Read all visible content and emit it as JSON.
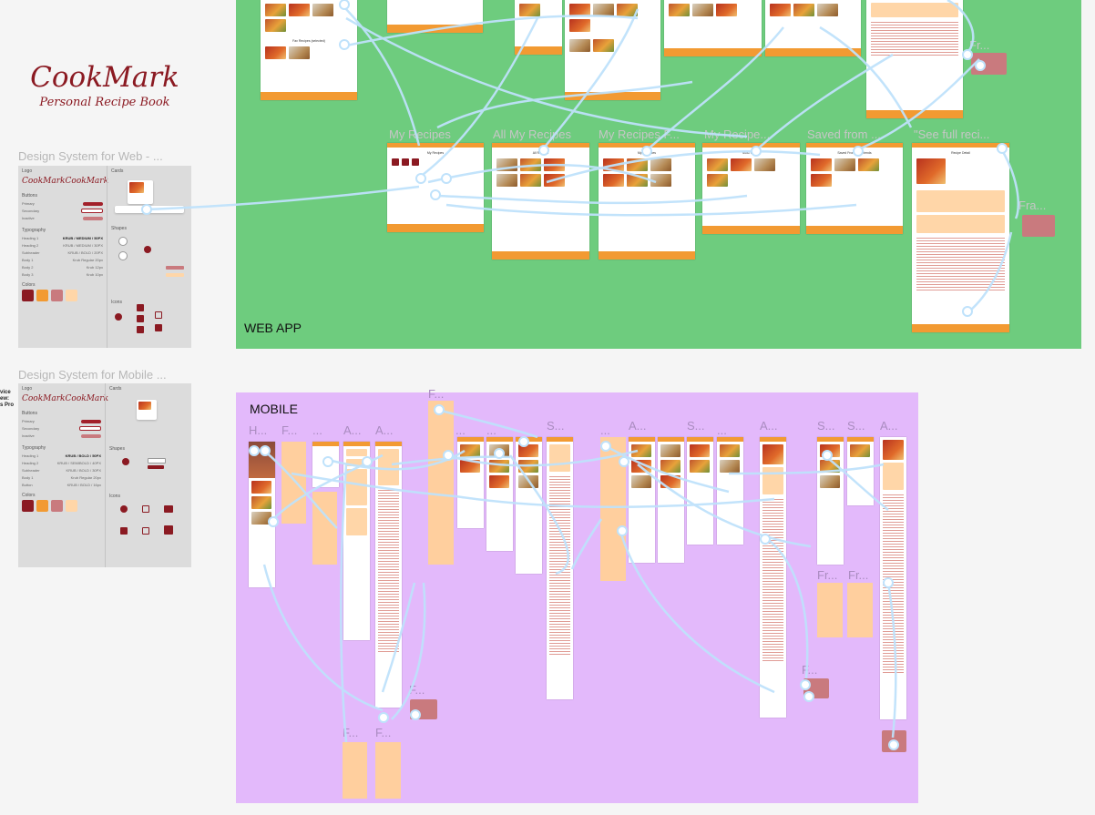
{
  "brand": {
    "logo": "CookMark",
    "tagline": "Personal Recipe Book"
  },
  "design_systems": {
    "web": {
      "title": "Design System for Web - ...",
      "sections": [
        "Logo",
        "Buttons",
        "Typography",
        "Colors",
        "Cards",
        "Shapes",
        "Icons"
      ],
      "typography_sample": "KRUB / MEDIUM / 50PX"
    },
    "mobile": {
      "title": "Design System for Mobile ...",
      "sections": [
        "Logo",
        "Buttons",
        "Typography",
        "Colors",
        "Cards",
        "Shapes",
        "Icons"
      ],
      "typography_sample": "KRUB / BOLD / 50PX"
    },
    "swatch_colors": [
      "#8b1a22",
      "#f29a32",
      "#c97a7e",
      "#ffd6a8"
    ]
  },
  "web_app": {
    "label": "WEB APP",
    "bg_color": "#6ecc7e",
    "frame_labels": [
      "My Recipes",
      "All My Recipes",
      "My Recipes F...",
      "My Recipe...",
      "Saved from ...",
      "\"See full reci..."
    ],
    "side_labels": [
      "Fr...",
      "Fra..."
    ]
  },
  "mobile": {
    "label": "MOBILE",
    "bg_color": "#e3b9fb",
    "frame_labels": [
      "F...",
      "H...",
      "F...",
      "...",
      "A...",
      "A...",
      "...",
      "...",
      "S...",
      "...",
      "A...",
      "S...",
      "...",
      "A...",
      "S...",
      "S...",
      "A..."
    ],
    "lower_labels": [
      "F...",
      "F...",
      "F...",
      "F...",
      "Fr...",
      "Fr..."
    ]
  },
  "device_note": "vice\new:\n Pro",
  "colors": {
    "connector": "#bfe2fb",
    "accent": "#8b1a22",
    "orange": "#f29a32",
    "peach": "#ffcf9e"
  }
}
